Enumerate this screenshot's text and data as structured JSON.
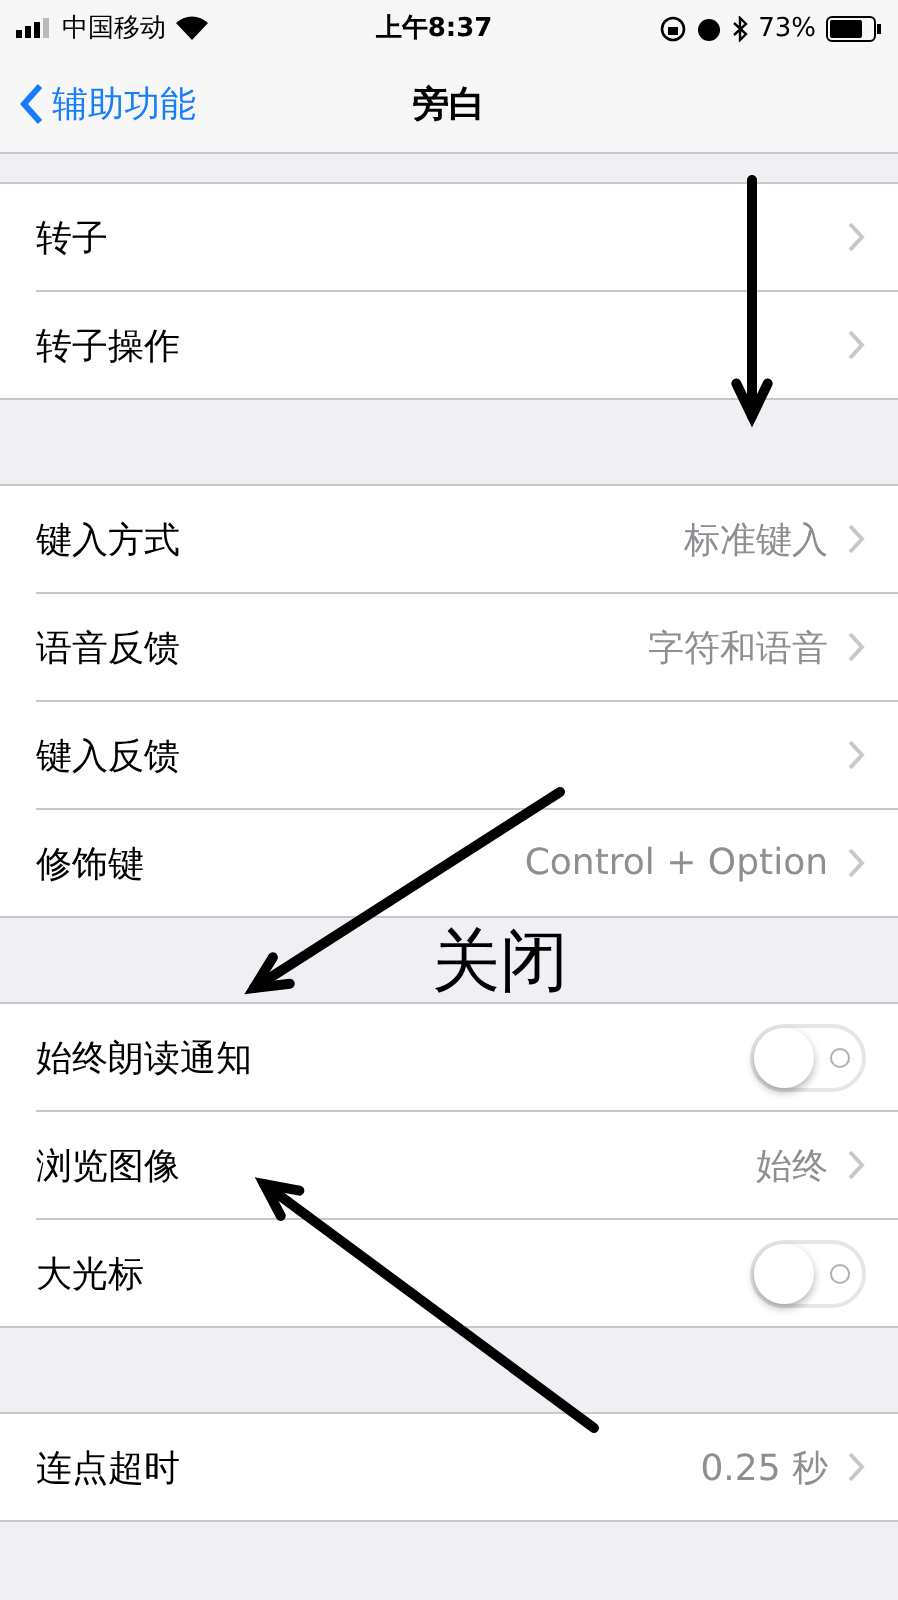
{
  "status_bar": {
    "carrier": "中国移动",
    "time": "上午8:37",
    "battery": "73%"
  },
  "nav": {
    "back": "辅助功能",
    "title": "旁白"
  },
  "groups": [
    {
      "rows": [
        {
          "kind": "link",
          "label": "转子"
        },
        {
          "kind": "link",
          "label": "转子操作"
        }
      ]
    },
    {
      "rows": [
        {
          "kind": "link",
          "label": "键入方式",
          "value": "标准键入"
        },
        {
          "kind": "link",
          "label": "语音反馈",
          "value": "字符和语音"
        },
        {
          "kind": "link",
          "label": "键入反馈"
        },
        {
          "kind": "link",
          "label": "修饰键",
          "value": "Control + Option"
        }
      ]
    },
    {
      "rows": [
        {
          "kind": "toggle",
          "label": "始终朗读通知",
          "on": false
        },
        {
          "kind": "link",
          "label": "浏览图像",
          "value": "始终"
        },
        {
          "kind": "toggle",
          "label": "大光标",
          "on": false
        }
      ]
    },
    {
      "rows": [
        {
          "kind": "link",
          "label": "连点超时",
          "value": "0.25 秒"
        }
      ]
    }
  ],
  "annotation": {
    "label": "关闭"
  }
}
